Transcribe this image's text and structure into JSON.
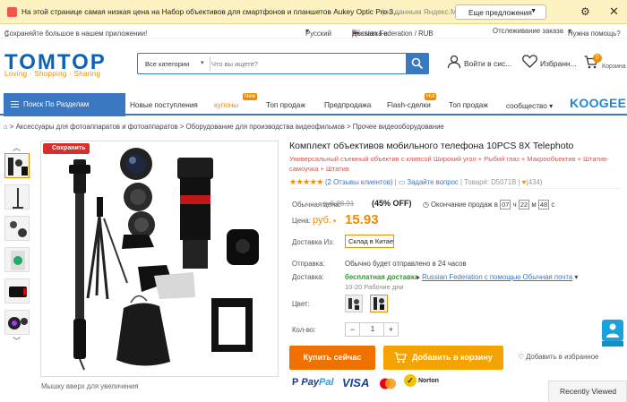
{
  "yandex_bar": {
    "message": "На этой странице самая низкая цена на Набор объективов для смартфонов и планшетов Aukey Optic Pro 3...",
    "source": "(по данным Яндекс.Маркета)",
    "button_label": "Еще предложения"
  },
  "top_links": {
    "save_bonus": "Сохраняйте большое в нашем приложении!",
    "language": "Русский",
    "delivery_label": "Доставка в",
    "delivery_value": "Russian Federation / RUB",
    "order_tracking": "Отслеживание заказа",
    "need_help": "Нужна помощь?"
  },
  "header": {
    "logo": "TOMTOP",
    "tagline": "Loving · Shopping · Sharing",
    "search_category": "Все категории",
    "search_placeholder": "Что вы ищете?",
    "signin": "Войти в сис...",
    "favorites": "Избранн...",
    "cart_count": "0",
    "cart_label": "Корзина"
  },
  "nav": {
    "categories_label": "Поиск По Разделам",
    "items": [
      {
        "label": "Новые поступления"
      },
      {
        "label": "купоны",
        "badge": "New"
      },
      {
        "label": "Топ продаж"
      },
      {
        "label": "Предпродажа"
      },
      {
        "label": "Flash-сделки",
        "badge": "Hot"
      },
      {
        "label": "Топ продаж"
      },
      {
        "label": "сообщество"
      }
    ],
    "brand": "KOOGEEK"
  },
  "breadcrumb": "Аксессуары для фотоаппаратов и фотоаппаратов > Оборудование для производства видеофильмов > Прочее видеооборудование",
  "gallery": {
    "save_badge": "Сохранить",
    "zoom_hint": "Мышку вверх для увеличения"
  },
  "product": {
    "title": "Комплект объективов мобильного телефона 10PCS 8X Telephoto",
    "subtitle": "Универсальный съемный объектив с клипсой Широкий угол + Рыбий глаз + Макрообъектив + Штатив-самоучка + Штатив",
    "stars": "★★★★★",
    "reviews": "(2 Отзывы клиентов)",
    "ask": "Задайте вопрос",
    "sku": "Товар#: D5071B",
    "likes": "(434)",
    "regular_price_label": "Обычная цена:",
    "regular_price": "руб.28.91",
    "discount": "(45% OFF)",
    "sale_ends_label": "Окончание продаж в",
    "timer_h": "07",
    "timer_m": "22",
    "timer_s": "48",
    "price_label": "Цена:",
    "currency": "руб.",
    "price": "15.93",
    "ship_from_label": "Доставка Из:",
    "ship_from": "Склад в Китае",
    "dispatch_label": "Отправка:",
    "dispatch": "Обычно будет отправлено в 24 часов",
    "delivery_label": "Доставка:",
    "free_shipping": "бесплатная доставка",
    "ship_via": "Russian Federation с помощью Обычная почта",
    "delivery_days": "10-20 Рабочие дни",
    "color_label": "Цвет:",
    "qty_label": "Кол-во:",
    "qty": "1",
    "buy_now": "Купить сейчас",
    "add_to_cart": "Добавить в корзину",
    "add_favorite": "Добавить в избранное"
  },
  "payment": {
    "paypal_a": "Pay",
    "paypal_b": "Pal",
    "visa": "VISA",
    "norton": "Norton"
  },
  "recently_viewed": "Recently Viewed"
}
